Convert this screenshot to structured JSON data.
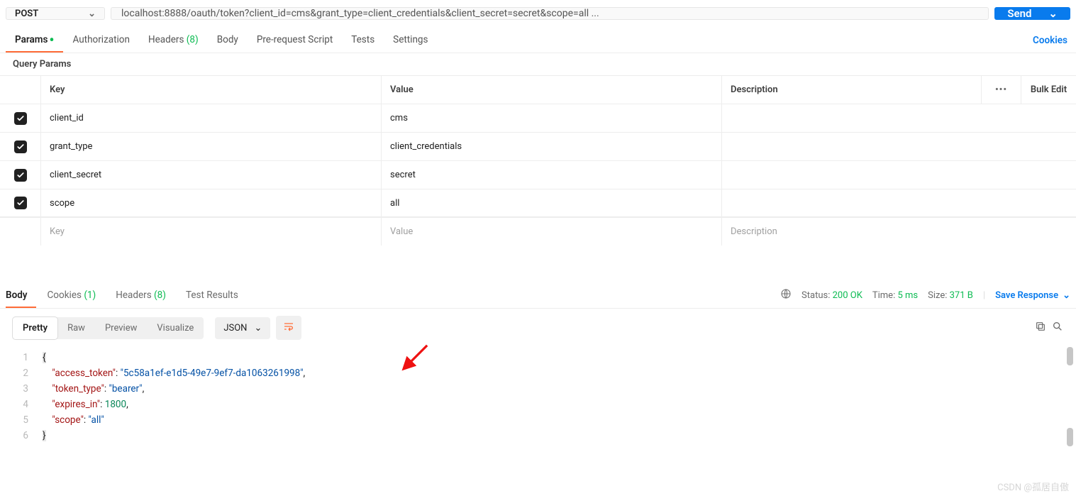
{
  "request": {
    "method": "POST",
    "url": "localhost:8888/oauth/token?client_id=cms&grant_type=client_credentials&client_secret=secret&scope=all ...",
    "send_label": "Send"
  },
  "req_tabs": {
    "params": "Params",
    "auth": "Authorization",
    "headers": "Headers",
    "headers_count": "(8)",
    "body": "Body",
    "prereq": "Pre-request Script",
    "tests": "Tests",
    "settings": "Settings",
    "cookies": "Cookies"
  },
  "query_params": {
    "section_title": "Query Params",
    "columns": {
      "key": "Key",
      "value": "Value",
      "desc": "Description",
      "bulk": "Bulk Edit"
    },
    "placeholders": {
      "key": "Key",
      "value": "Value",
      "desc": "Description"
    },
    "rows": [
      {
        "key": "client_id",
        "value": "cms"
      },
      {
        "key": "grant_type",
        "value": "client_credentials"
      },
      {
        "key": "client_secret",
        "value": "secret"
      },
      {
        "key": "scope",
        "value": "all"
      }
    ]
  },
  "resp_tabs": {
    "body": "Body",
    "cookies": "Cookies",
    "cookies_count": "(1)",
    "headers": "Headers",
    "headers_count": "(8)",
    "test_results": "Test Results"
  },
  "resp_meta": {
    "status_label": "Status:",
    "status_value": "200 OK",
    "time_label": "Time:",
    "time_value": "5 ms",
    "size_label": "Size:",
    "size_value": "371 B",
    "save_response": "Save Response"
  },
  "body_toolbar": {
    "pretty": "Pretty",
    "raw": "Raw",
    "preview": "Preview",
    "visualize": "Visualize",
    "lang": "JSON"
  },
  "response_json": {
    "access_token": "5c58a1ef-e1d5-49e7-9ef7-da1063261998",
    "token_type": "bearer",
    "expires_in": 1800,
    "scope": "all"
  },
  "watermark": "CSDN @孤居自傲"
}
